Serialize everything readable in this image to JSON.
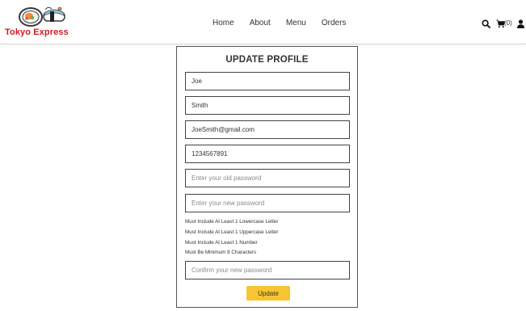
{
  "brand": {
    "name": "Tokyo Express",
    "logo_icon": "sushi-logo-icon",
    "color": "#d21b22"
  },
  "nav": {
    "items": [
      "Home",
      "About",
      "Menu",
      "Orders"
    ]
  },
  "header_actions": {
    "search_icon": "search-icon",
    "cart_icon": "cart-icon",
    "cart_count": "(0)",
    "user_icon": "user-icon"
  },
  "form": {
    "title": "UPDATE PROFILE",
    "first_name": {
      "value": "Joe"
    },
    "last_name": {
      "value": "Smith"
    },
    "email": {
      "value": "JoeSmith@gmail.com"
    },
    "phone": {
      "value": "1234567891"
    },
    "old_password": {
      "value": "",
      "placeholder": "Enter your old password"
    },
    "new_password": {
      "value": "",
      "placeholder": "Enter your new password"
    },
    "password_rules": [
      "Must Include At Least 1 Lowercase Letter",
      "Must Include At Least 1 Uppercase Letter",
      "Must Include At Least 1 Number",
      "Must Be Minimum 8 Characters"
    ],
    "confirm_password": {
      "value": "",
      "placeholder": "Confirm your new password"
    },
    "submit_label": "Update",
    "submit_color": "#f6c531"
  }
}
